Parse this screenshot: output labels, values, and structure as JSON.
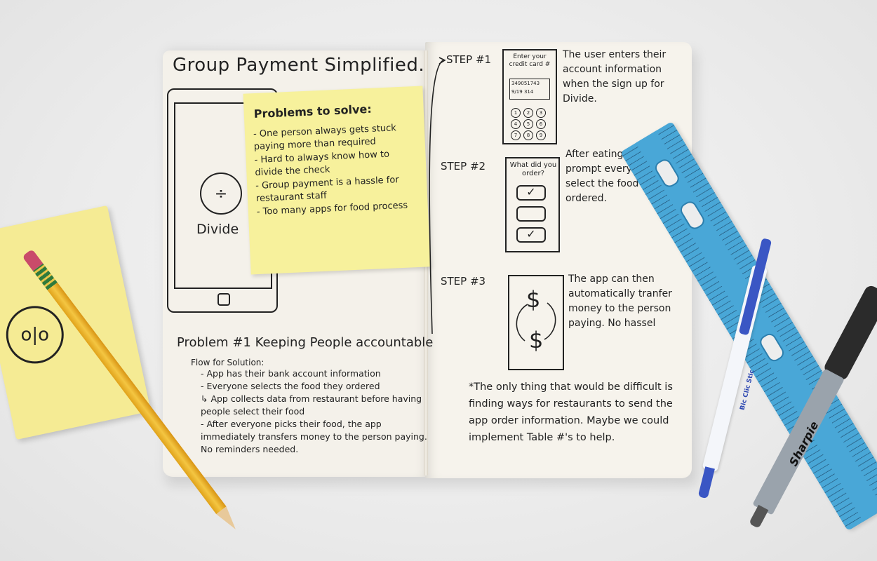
{
  "left_page": {
    "title": "Group Payment Simplified.",
    "phone_app_name": "Divide",
    "phone_logo_glyph": "÷",
    "sticky": {
      "title": "Problems to solve:",
      "items": [
        "- One person always gets stuck paying more than required",
        "- Hard to always know how to divide the check",
        "- Group payment is a hassle for restaurant staff",
        "- Too many apps for food process"
      ]
    },
    "problem_heading": "Problem #1 Keeping People accountable",
    "flow_title": "Flow for Solution:",
    "flow_items": [
      "- App has their bank account information",
      "- Everyone selects the food they ordered",
      "↳ App collects data from restaurant before having people select their food",
      "- After everyone picks their food, the app immediately transfers money to the person paying. No reminders needed."
    ]
  },
  "right_page": {
    "steps": [
      {
        "label": "STEP #1",
        "card_text": "Enter your credit card #",
        "card_number": "349051743",
        "card_expiry": "9/19  314",
        "keys": [
          "1",
          "2",
          "3",
          "4",
          "5",
          "6",
          "7",
          "8",
          "9"
        ],
        "description": "The user enters their account information when the sign up for Divide."
      },
      {
        "label": "STEP #2",
        "card_text": "What did you order?",
        "checks": [
          "✓",
          "",
          "✓"
        ],
        "description": "After eating the app will prompt everyone to select the food they ordered."
      },
      {
        "label": "STEP #3",
        "symbol_top": "$",
        "symbol_bottom": "$",
        "description": "The app can then automatically tranfer money to the person paying. No hassel"
      }
    ],
    "note": "*The only thing that would be difficult is finding ways for restaurants to send the app order information. Maybe we could implement Table #'s to help."
  },
  "desk": {
    "pad_logo_glyph": "o|o",
    "pen1_brand": "Bic Clic Stic",
    "pen2_brand": "Sharpie",
    "colors": {
      "sticky": "#f7f19c",
      "ruler": "#49a7d7",
      "pen_blue": "#3a56c4",
      "pencil": "#f4c642"
    }
  }
}
